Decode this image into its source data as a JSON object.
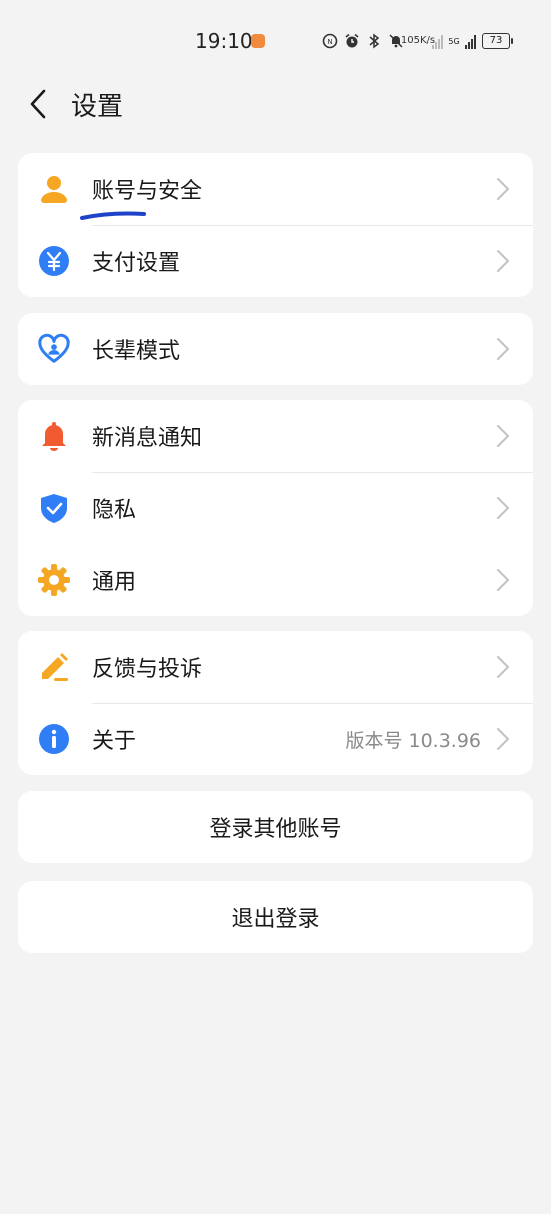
{
  "status_bar": {
    "time": "19:10",
    "net_speed_value": "105",
    "net_speed_unit": "K/s",
    "network_type": "5G",
    "battery": "73"
  },
  "header": {
    "title": "设置"
  },
  "groups": [
    {
      "items": [
        {
          "label": "账号与安全",
          "icon": "user-icon",
          "color": "#f5a623"
        },
        {
          "label": "支付设置",
          "icon": "yuan-icon",
          "color": "#2f7ef5"
        }
      ]
    },
    {
      "items": [
        {
          "label": "长辈模式",
          "icon": "heart-care-icon",
          "color": "#2f7ef5"
        }
      ]
    },
    {
      "items": [
        {
          "label": "新消息通知",
          "icon": "bell-icon",
          "color": "#f25a32"
        },
        {
          "label": "隐私",
          "icon": "shield-icon",
          "color": "#2f7ef5"
        },
        {
          "label": "通用",
          "icon": "gear-icon",
          "color": "#f5a623"
        }
      ]
    },
    {
      "items": [
        {
          "label": "反馈与投诉",
          "icon": "edit-icon",
          "color": "#f5a623"
        },
        {
          "label": "关于",
          "icon": "info-icon",
          "color": "#2f7ef5",
          "value": "版本号 10.3.96"
        }
      ]
    }
  ],
  "buttons": {
    "switch_account": "登录其他账号",
    "logout": "退出登录"
  }
}
